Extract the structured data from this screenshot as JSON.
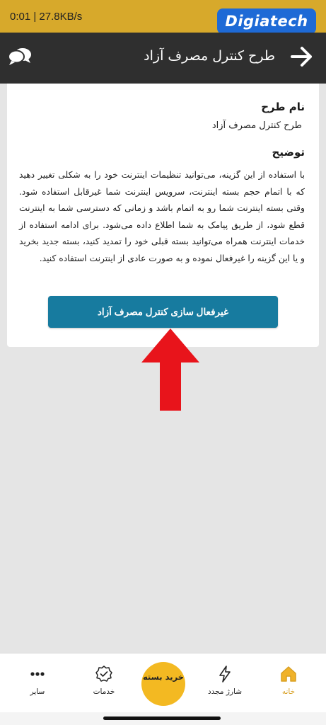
{
  "status": {
    "time_speed": "0:01 | 27.8KB/s",
    "watermark": "Digiatech"
  },
  "app_bar": {
    "title": "طرح کنترل مصرف آزاد"
  },
  "card": {
    "name_label": "نام طرح",
    "name_value": "طرح کنترل مصرف آزاد",
    "description_label": "توضیح",
    "description": "با استفاده از این گزینه، می‌توانید تنظیمات اینترنت خود را به شکلی تغییر دهید که با اتمام حجم بسته اینترنت، سرویس اینترنت شما غیرقابل استفاده شود. وقتی بسته اینترنت شما رو به اتمام باشد و زمانی که دسترسی شما به اینترنت قطع شود، از طریق پیامک به شما اطلاع داده می‌شود. برای ادامه استفاده از خدمات اینترنت همراه می‌توانید بسته قبلی خود را تمدید کنید، بسته جدید بخرید و یا این گزینه را غیرفعال نموده و به صورت عادی از اینترنت استفاده کنید.",
    "button_label": "غیرفعال سازی کنترل مصرف آزاد"
  },
  "bottom_nav": {
    "home": "خانه",
    "recharge": "شارژ مجدد",
    "buy_package": "خرید بسته",
    "services": "خدمات",
    "more": "سایر"
  },
  "colors": {
    "status_bar": "#d7a92b",
    "app_bar": "#2f2f2f",
    "button": "#177b9f",
    "accent": "#f3b922",
    "annotation_arrow": "#e8141b"
  }
}
